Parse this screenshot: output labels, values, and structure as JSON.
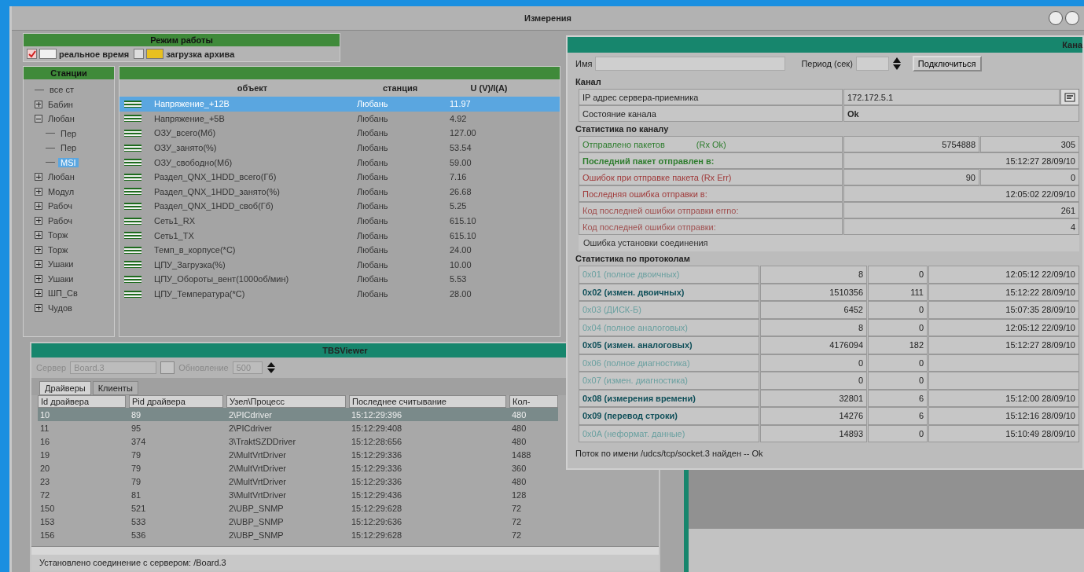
{
  "main_window": {
    "title": "Измерения"
  },
  "mode_panel": {
    "title": "Режим работы",
    "options": [
      {
        "kind": "realtime",
        "label": "реальное время",
        "checked": true
      },
      {
        "kind": "archive",
        "label": "загрузка архива",
        "checked": false
      }
    ]
  },
  "stations": {
    "title": "Станции",
    "tree": [
      {
        "label": "все ст",
        "kind": "root",
        "selected": false
      },
      {
        "label": "Бабин",
        "expanded": false,
        "selected": false
      },
      {
        "label": "Любан",
        "expanded": true,
        "selected": false,
        "children": [
          {
            "label": "Пер",
            "selected": false
          },
          {
            "label": "Пер",
            "selected": false
          },
          {
            "label": "MSI",
            "selected": true
          }
        ]
      },
      {
        "label": "Любан",
        "expanded": false,
        "selected": false
      },
      {
        "label": "Модул",
        "expanded": false,
        "selected": false
      },
      {
        "label": "Рабоч",
        "expanded": false,
        "selected": false
      },
      {
        "label": "Рабоч",
        "expanded": false,
        "selected": false
      },
      {
        "label": "Торж",
        "expanded": false,
        "selected": false
      },
      {
        "label": "Торж",
        "expanded": false,
        "selected": false
      },
      {
        "label": "Ушаки",
        "expanded": false,
        "selected": false
      },
      {
        "label": "Ушаки",
        "expanded": false,
        "selected": false
      },
      {
        "label": "ШП_Св",
        "expanded": false,
        "selected": false
      },
      {
        "label": "Чудов",
        "expanded": false,
        "selected": false
      }
    ]
  },
  "objects": {
    "columns": [
      "объект",
      "станция",
      "U (V)/I(A)"
    ],
    "rows": [
      {
        "name": "Напряжение_+12В",
        "station": "Любань",
        "value": "11.97",
        "selected": true
      },
      {
        "name": "Напряжение_+5В",
        "station": "Любань",
        "value": "4.92",
        "selected": false
      },
      {
        "name": "ОЗУ_всего(Мб)",
        "station": "Любань",
        "value": "127.00",
        "selected": false
      },
      {
        "name": "ОЗУ_занято(%)",
        "station": "Любань",
        "value": "53.54",
        "selected": false
      },
      {
        "name": "ОЗУ_свободно(Мб)",
        "station": "Любань",
        "value": "59.00",
        "selected": false
      },
      {
        "name": "Раздел_QNX_1HDD_всего(Гб)",
        "station": "Любань",
        "value": "7.16",
        "selected": false
      },
      {
        "name": "Раздел_QNX_1HDD_занято(%)",
        "station": "Любань",
        "value": "26.68",
        "selected": false
      },
      {
        "name": "Раздел_QNX_1HDD_своб(Гб)",
        "station": "Любань",
        "value": "5.25",
        "selected": false
      },
      {
        "name": "Сеть1_RX",
        "station": "Любань",
        "value": "615.10",
        "selected": false
      },
      {
        "name": "Сеть1_TX",
        "station": "Любань",
        "value": "615.10",
        "selected": false
      },
      {
        "name": "Темп_в_корпусе(*С)",
        "station": "Любань",
        "value": "24.00",
        "selected": false
      },
      {
        "name": "ЦПУ_Загрузка(%)",
        "station": "Любань",
        "value": "10.00",
        "selected": false
      },
      {
        "name": "ЦПУ_Обороты_вент(1000об/мин)",
        "station": "Любань",
        "value": "5.53",
        "selected": false
      },
      {
        "name": "ЦПУ_Температура(*С)",
        "station": "Любань",
        "value": "28.00",
        "selected": false
      }
    ]
  },
  "tbs_viewer": {
    "title": "TBSViewer",
    "server_label": "Сервер",
    "server": "Board.3",
    "refresh_label": "Обновление",
    "refresh": "500",
    "tabs": [
      {
        "label": "Драйверы",
        "selected": true
      },
      {
        "label": "Клиенты",
        "selected": false
      }
    ],
    "columns": [
      "Id драйвера",
      "Pid драйвера",
      "Узел\\Процесс",
      "Последнее считывание",
      "Кол-"
    ],
    "rows": [
      {
        "cells": [
          "10",
          "89",
          "2\\PICdriver",
          "15:12:29:396",
          "480"
        ],
        "selected": true
      },
      {
        "cells": [
          "11",
          "95",
          "2\\PICdriver",
          "15:12:29:408",
          "480"
        ],
        "selected": false
      },
      {
        "cells": [
          "16",
          "374",
          "3\\TraktSZDDriver",
          "15:12:28:656",
          "480"
        ],
        "selected": false
      },
      {
        "cells": [
          "19",
          "79",
          "2\\MultVrtDriver",
          "15:12:29:336",
          "1488"
        ],
        "selected": false
      },
      {
        "cells": [
          "20",
          "79",
          "2\\MultVrtDriver",
          "15:12:29:336",
          "360"
        ],
        "selected": false
      },
      {
        "cells": [
          "23",
          "79",
          "2\\MultVrtDriver",
          "15:12:29:336",
          "480"
        ],
        "selected": false
      },
      {
        "cells": [
          "72",
          "81",
          "3\\MultVrtDriver",
          "15:12:29:436",
          "128"
        ],
        "selected": false
      },
      {
        "cells": [
          "150",
          "521",
          "2\\UBP_SNMP",
          "15:12:29:628",
          "72"
        ],
        "selected": false
      },
      {
        "cells": [
          "153",
          "533",
          "2\\UBP_SNMP",
          "15:12:29:636",
          "72"
        ],
        "selected": false
      },
      {
        "cells": [
          "156",
          "536",
          "2\\UBP_SNMP",
          "15:12:29:628",
          "72"
        ],
        "selected": false
      }
    ],
    "status": "Установлено соединение с сервером: /Board.3"
  },
  "channel_window": {
    "title": "Кана",
    "name_label": "Имя",
    "period_label": "Период (сек)",
    "connect_button": "Подключиться",
    "channel_heading": "Канал",
    "channel_rows": [
      {
        "label": "IP адрес сервера-приемника",
        "value": "172.172.5.1",
        "kind": "ip"
      },
      {
        "label": "Состояние канала",
        "value": "Ok",
        "kind": "status"
      }
    ],
    "stats_heading": "Статистика по каналу",
    "stats": [
      {
        "kind": "pair",
        "label": "Отправлено пакетов",
        "note": "(Rx Ok)",
        "value": "5754888",
        "value2": "305",
        "color": "#2e7d2e",
        "bold": false
      },
      {
        "kind": "single",
        "label": "Последний пакет отправлен в:",
        "value": "15:12:27 28/09/10",
        "color": "#2e7d2e",
        "bold": true
      },
      {
        "kind": "pair",
        "label": "Ошибок при отправке пакета (Rx Err)",
        "value": "90",
        "value2": "0",
        "color": "#a03a3a",
        "bold": false
      },
      {
        "kind": "single",
        "label": "Последняя ошибка отправки в:",
        "value": "12:05:02 22/09/10",
        "color": "#a03a3a",
        "bold": false
      },
      {
        "kind": "single",
        "label": "Код последней ошибки отправки errno:",
        "value": "261",
        "color": "#a05050",
        "bold": false
      },
      {
        "kind": "single",
        "label": "Код последней ошибки отправки:",
        "value": "4",
        "color": "#a05050",
        "bold": false
      },
      {
        "kind": "message",
        "label": "Ошибка установки соединения",
        "color": "#303030"
      }
    ],
    "protocols_heading": "Статистика по протоколам",
    "protocols": [
      {
        "name": "0x01 (полное двоичных)",
        "count": "8",
        "errors": "0",
        "time": "12:05:12 22/09/10",
        "active": false
      },
      {
        "name": "0x02 (измен. двоичных)",
        "count": "1510356",
        "errors": "111",
        "time": "15:12:22 28/09/10",
        "active": true
      },
      {
        "name": "0x03 (ДИСК-Б)",
        "count": "6452",
        "errors": "0",
        "time": "15:07:35 28/09/10",
        "active": false
      },
      {
        "name": "0x04 (полное аналоговых)",
        "count": "8",
        "errors": "0",
        "time": "12:05:12 22/09/10",
        "active": false
      },
      {
        "name": "0x05 (измен. аналоговых)",
        "count": "4176094",
        "errors": "182",
        "time": "15:12:27 28/09/10",
        "active": true
      },
      {
        "name": "0x06 (полное диагностика)",
        "count": "0",
        "errors": "0",
        "active": false
      },
      {
        "name": "0x07 (измен. диагностика)",
        "count": "0",
        "errors": "0",
        "active": false
      },
      {
        "name": "0x08 (измерения времени)",
        "count": "32801",
        "errors": "6",
        "time": "15:12:00 28/09/10",
        "active": true
      },
      {
        "name": "0x09 (перевод строки)",
        "count": "14276",
        "errors": "6",
        "time": "15:12:16 28/09/10",
        "active": true
      },
      {
        "name": "0x0A (неформат. данные)",
        "count": "14893",
        "errors": "0",
        "time": "15:10:49 28/09/10",
        "active": false
      }
    ],
    "status": "Поток по имени /udcs/tcp/socket.3 найден -- Ok"
  }
}
